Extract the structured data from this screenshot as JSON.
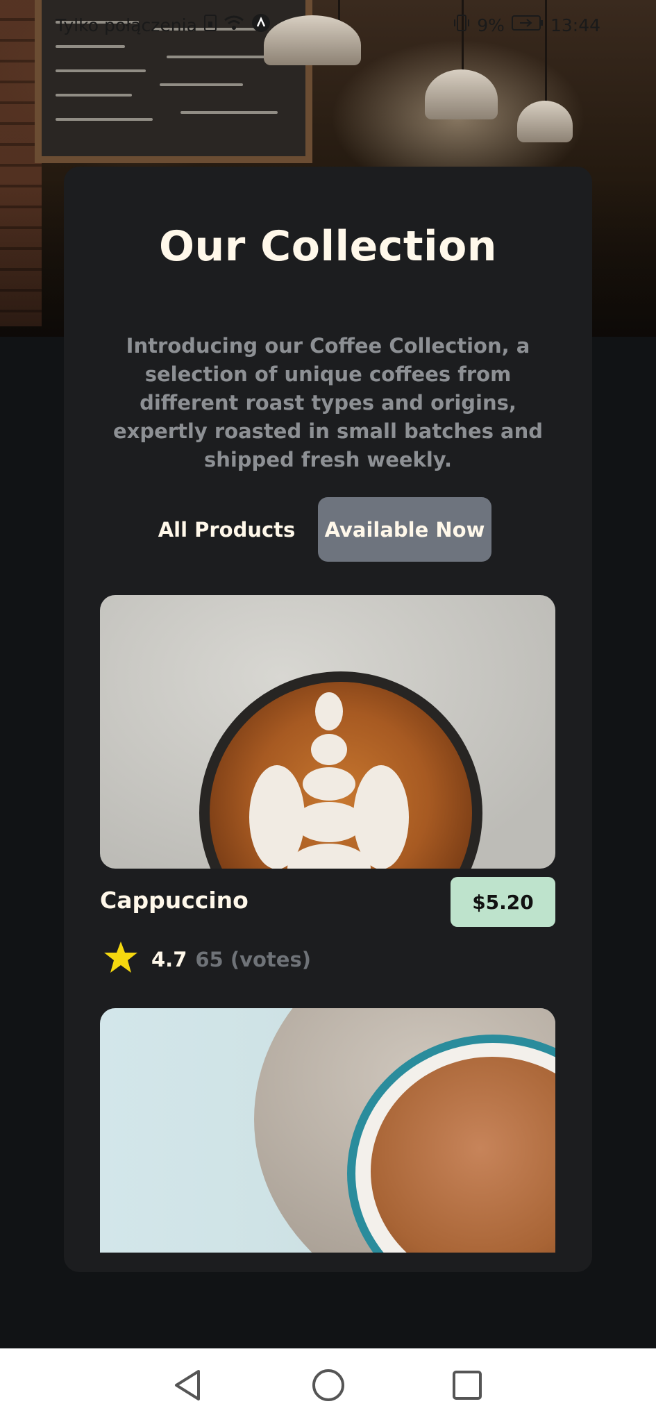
{
  "status_bar": {
    "carrier_text": "Tylko połączenia",
    "battery_percent": "9%",
    "time": "13:44"
  },
  "collection": {
    "title": "Our Collection",
    "description": "Introducing our Coffee Collection, a selection of unique coffees from different roast types and origins, expertly roasted in small batches and shipped fresh weekly.",
    "tabs": [
      {
        "label": "All Products",
        "selected": false
      },
      {
        "label": "Available Now",
        "selected": true
      }
    ]
  },
  "products": [
    {
      "name": "Cappuccino",
      "price": "$5.20",
      "rating": "4.7",
      "votes": "65 (votes)",
      "image_icon": "cappuccino-photo"
    },
    {
      "image_icon": "coffee-cup-photo"
    }
  ],
  "nav": {
    "back_icon": "back-triangle-icon",
    "home_icon": "home-circle-icon",
    "recents_icon": "recents-square-icon"
  },
  "colors": {
    "background": "#111315",
    "card": "#1c1d1f",
    "tab_selected": "#6e747e",
    "price_badge": "#bee3cc",
    "star": "#f5d80f",
    "title_text": "#fff8ea"
  }
}
